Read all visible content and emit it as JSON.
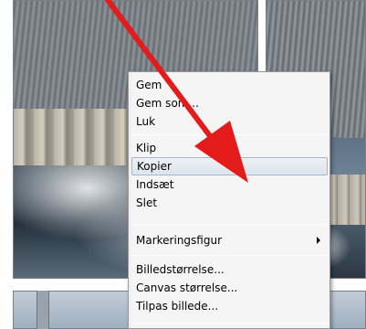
{
  "context_menu": {
    "items": [
      {
        "label": "Gem"
      },
      {
        "label": "Gem som..."
      },
      {
        "label": "Luk"
      },
      {
        "label": "Klip"
      },
      {
        "label": "Kopier"
      },
      {
        "label": "Indsæt"
      },
      {
        "label": "Slet"
      },
      {
        "label": "Markeringsfigur"
      },
      {
        "label": "Billedstørrelse..."
      },
      {
        "label": "Canvas størrelse..."
      },
      {
        "label": "Tilpas billede..."
      }
    ],
    "highlighted": "Kopier"
  },
  "annotation": {
    "arrow_color": "#e31b1b"
  }
}
